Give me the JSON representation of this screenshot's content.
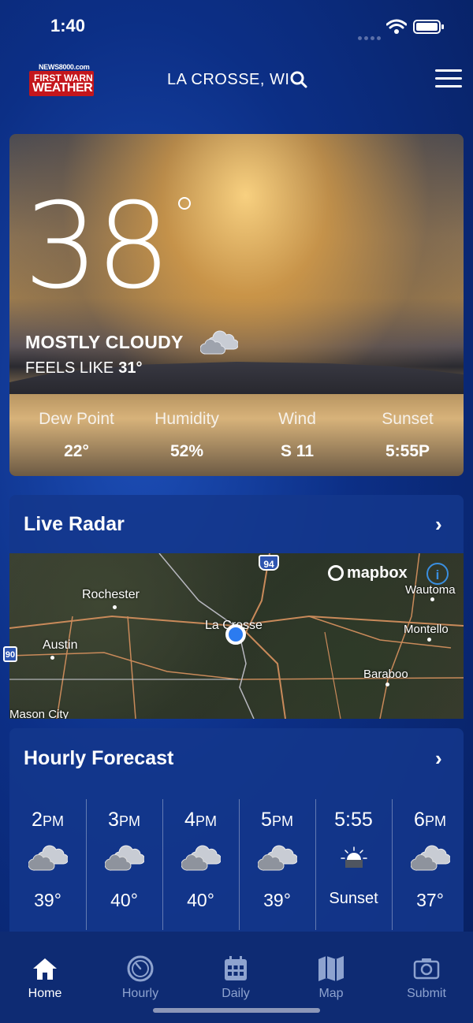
{
  "status": {
    "time": "1:40"
  },
  "header": {
    "logo_small": "NEWS8000.com",
    "logo_line1": "FIRST WARN",
    "logo_line2": "WEATHER",
    "city": "LA CROSSE, WI"
  },
  "current": {
    "temperature": "38",
    "condition": "MOSTLY CLOUDY",
    "feels_like_label": "FEELS LIKE",
    "feels_like_value": "31°",
    "stats": [
      {
        "label": "Dew Point",
        "value": "22°"
      },
      {
        "label": "Humidity",
        "value": "52%"
      },
      {
        "label": "Wind",
        "value": "S 11"
      },
      {
        "label": "Sunset",
        "value": "5:55P"
      }
    ]
  },
  "radar": {
    "title": "Live Radar",
    "attribution": "mapbox",
    "info": "i",
    "labels": {
      "rochester": "Rochester",
      "lacrosse": "La Crosse",
      "austin": "Austin",
      "montello": "Montello",
      "wautoma": "Wautoma",
      "baraboo": "Baraboo",
      "masoncity": "Mason City",
      "hwy94": "94",
      "hwy90": "90"
    }
  },
  "hourly": {
    "title": "Hourly Forecast",
    "items": [
      {
        "hour": "2",
        "suffix": "PM",
        "icon": "cloudy-icon",
        "temp": "39°"
      },
      {
        "hour": "3",
        "suffix": "PM",
        "icon": "cloudy-icon",
        "temp": "40°"
      },
      {
        "hour": "4",
        "suffix": "PM",
        "icon": "cloudy-icon",
        "temp": "40°"
      },
      {
        "hour": "5",
        "suffix": "PM",
        "icon": "cloudy-icon",
        "temp": "39°"
      },
      {
        "hour": "5:55",
        "suffix": "",
        "icon": "sunset-icon",
        "temp": "Sunset"
      },
      {
        "hour": "6",
        "suffix": "PM",
        "icon": "cloudy-icon",
        "temp": "37°"
      }
    ]
  },
  "tabs": [
    {
      "label": "Home",
      "icon": "home-icon",
      "active": true
    },
    {
      "label": "Hourly",
      "icon": "clock-icon",
      "active": false
    },
    {
      "label": "Daily",
      "icon": "calendar-icon",
      "active": false
    },
    {
      "label": "Map",
      "icon": "map-icon",
      "active": false
    },
    {
      "label": "Submit",
      "icon": "camera-icon",
      "active": false
    }
  ],
  "colors": {
    "accent": "#2b7bf0",
    "logo_red": "#c4161c",
    "panel": "#14378c"
  }
}
